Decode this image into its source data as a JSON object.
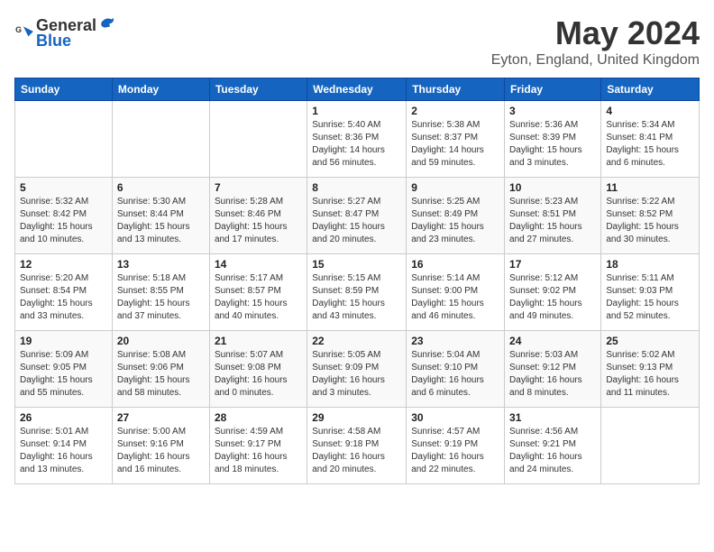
{
  "header": {
    "logo_general": "General",
    "logo_blue": "Blue",
    "month": "May 2024",
    "location": "Eyton, England, United Kingdom"
  },
  "weekdays": [
    "Sunday",
    "Monday",
    "Tuesday",
    "Wednesday",
    "Thursday",
    "Friday",
    "Saturday"
  ],
  "weeks": [
    [
      {
        "day": "",
        "info": ""
      },
      {
        "day": "",
        "info": ""
      },
      {
        "day": "",
        "info": ""
      },
      {
        "day": "1",
        "info": "Sunrise: 5:40 AM\nSunset: 8:36 PM\nDaylight: 14 hours\nand 56 minutes."
      },
      {
        "day": "2",
        "info": "Sunrise: 5:38 AM\nSunset: 8:37 PM\nDaylight: 14 hours\nand 59 minutes."
      },
      {
        "day": "3",
        "info": "Sunrise: 5:36 AM\nSunset: 8:39 PM\nDaylight: 15 hours\nand 3 minutes."
      },
      {
        "day": "4",
        "info": "Sunrise: 5:34 AM\nSunset: 8:41 PM\nDaylight: 15 hours\nand 6 minutes."
      }
    ],
    [
      {
        "day": "5",
        "info": "Sunrise: 5:32 AM\nSunset: 8:42 PM\nDaylight: 15 hours\nand 10 minutes."
      },
      {
        "day": "6",
        "info": "Sunrise: 5:30 AM\nSunset: 8:44 PM\nDaylight: 15 hours\nand 13 minutes."
      },
      {
        "day": "7",
        "info": "Sunrise: 5:28 AM\nSunset: 8:46 PM\nDaylight: 15 hours\nand 17 minutes."
      },
      {
        "day": "8",
        "info": "Sunrise: 5:27 AM\nSunset: 8:47 PM\nDaylight: 15 hours\nand 20 minutes."
      },
      {
        "day": "9",
        "info": "Sunrise: 5:25 AM\nSunset: 8:49 PM\nDaylight: 15 hours\nand 23 minutes."
      },
      {
        "day": "10",
        "info": "Sunrise: 5:23 AM\nSunset: 8:51 PM\nDaylight: 15 hours\nand 27 minutes."
      },
      {
        "day": "11",
        "info": "Sunrise: 5:22 AM\nSunset: 8:52 PM\nDaylight: 15 hours\nand 30 minutes."
      }
    ],
    [
      {
        "day": "12",
        "info": "Sunrise: 5:20 AM\nSunset: 8:54 PM\nDaylight: 15 hours\nand 33 minutes."
      },
      {
        "day": "13",
        "info": "Sunrise: 5:18 AM\nSunset: 8:55 PM\nDaylight: 15 hours\nand 37 minutes."
      },
      {
        "day": "14",
        "info": "Sunrise: 5:17 AM\nSunset: 8:57 PM\nDaylight: 15 hours\nand 40 minutes."
      },
      {
        "day": "15",
        "info": "Sunrise: 5:15 AM\nSunset: 8:59 PM\nDaylight: 15 hours\nand 43 minutes."
      },
      {
        "day": "16",
        "info": "Sunrise: 5:14 AM\nSunset: 9:00 PM\nDaylight: 15 hours\nand 46 minutes."
      },
      {
        "day": "17",
        "info": "Sunrise: 5:12 AM\nSunset: 9:02 PM\nDaylight: 15 hours\nand 49 minutes."
      },
      {
        "day": "18",
        "info": "Sunrise: 5:11 AM\nSunset: 9:03 PM\nDaylight: 15 hours\nand 52 minutes."
      }
    ],
    [
      {
        "day": "19",
        "info": "Sunrise: 5:09 AM\nSunset: 9:05 PM\nDaylight: 15 hours\nand 55 minutes."
      },
      {
        "day": "20",
        "info": "Sunrise: 5:08 AM\nSunset: 9:06 PM\nDaylight: 15 hours\nand 58 minutes."
      },
      {
        "day": "21",
        "info": "Sunrise: 5:07 AM\nSunset: 9:08 PM\nDaylight: 16 hours\nand 0 minutes."
      },
      {
        "day": "22",
        "info": "Sunrise: 5:05 AM\nSunset: 9:09 PM\nDaylight: 16 hours\nand 3 minutes."
      },
      {
        "day": "23",
        "info": "Sunrise: 5:04 AM\nSunset: 9:10 PM\nDaylight: 16 hours\nand 6 minutes."
      },
      {
        "day": "24",
        "info": "Sunrise: 5:03 AM\nSunset: 9:12 PM\nDaylight: 16 hours\nand 8 minutes."
      },
      {
        "day": "25",
        "info": "Sunrise: 5:02 AM\nSunset: 9:13 PM\nDaylight: 16 hours\nand 11 minutes."
      }
    ],
    [
      {
        "day": "26",
        "info": "Sunrise: 5:01 AM\nSunset: 9:14 PM\nDaylight: 16 hours\nand 13 minutes."
      },
      {
        "day": "27",
        "info": "Sunrise: 5:00 AM\nSunset: 9:16 PM\nDaylight: 16 hours\nand 16 minutes."
      },
      {
        "day": "28",
        "info": "Sunrise: 4:59 AM\nSunset: 9:17 PM\nDaylight: 16 hours\nand 18 minutes."
      },
      {
        "day": "29",
        "info": "Sunrise: 4:58 AM\nSunset: 9:18 PM\nDaylight: 16 hours\nand 20 minutes."
      },
      {
        "day": "30",
        "info": "Sunrise: 4:57 AM\nSunset: 9:19 PM\nDaylight: 16 hours\nand 22 minutes."
      },
      {
        "day": "31",
        "info": "Sunrise: 4:56 AM\nSunset: 9:21 PM\nDaylight: 16 hours\nand 24 minutes."
      },
      {
        "day": "",
        "info": ""
      }
    ]
  ]
}
